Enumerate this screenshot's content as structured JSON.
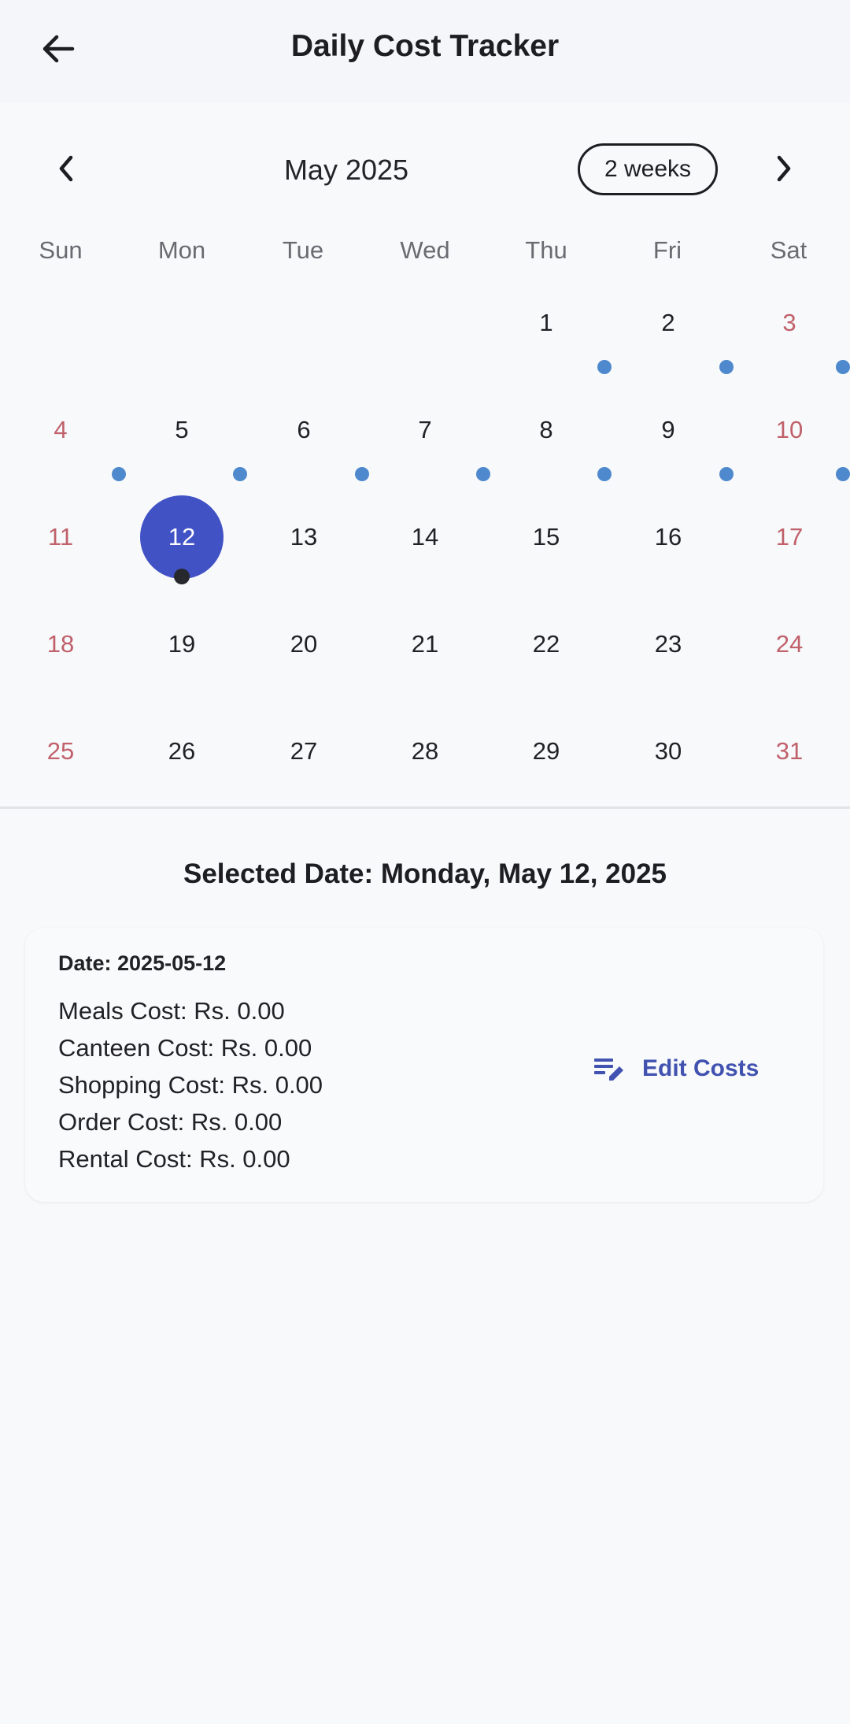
{
  "appbar": {
    "title": "Daily Cost Tracker",
    "back_icon": "arrow-back-icon"
  },
  "calendar": {
    "month_label": "May 2025",
    "format_button": "2 weeks",
    "weekdays": [
      "Sun",
      "Mon",
      "Tue",
      "Wed",
      "Thu",
      "Fri",
      "Sat"
    ],
    "weeks": [
      [
        "",
        "",
        "",
        "",
        "1",
        "2",
        "3"
      ],
      [
        "4",
        "5",
        "6",
        "7",
        "8",
        "9",
        "10"
      ],
      [
        "11",
        "12",
        "13",
        "14",
        "15",
        "16",
        "17"
      ],
      [
        "18",
        "19",
        "20",
        "21",
        "22",
        "23",
        "24"
      ],
      [
        "25",
        "26",
        "27",
        "28",
        "29",
        "30",
        "31"
      ]
    ],
    "selected_day": "12",
    "days_with_entries": [
      "1",
      "2",
      "3",
      "4",
      "5",
      "6",
      "7",
      "8",
      "9",
      "10"
    ],
    "colors": {
      "selected": "#4152c5",
      "event_dot": "#4f89cd",
      "weekend_text": "#c0616b"
    }
  },
  "selection": {
    "heading": "Selected Date: Monday, May 12, 2025"
  },
  "card": {
    "date_line": "Date: 2025-05-12",
    "costs": [
      "Meals Cost: Rs. 0.00",
      "Canteen Cost: Rs. 0.00",
      "Shopping Cost: Rs. 0.00",
      "Order Cost: Rs. 0.00",
      "Rental Cost: Rs. 0.00"
    ],
    "edit_label": "Edit Costs",
    "edit_icon": "edit-note-icon"
  }
}
